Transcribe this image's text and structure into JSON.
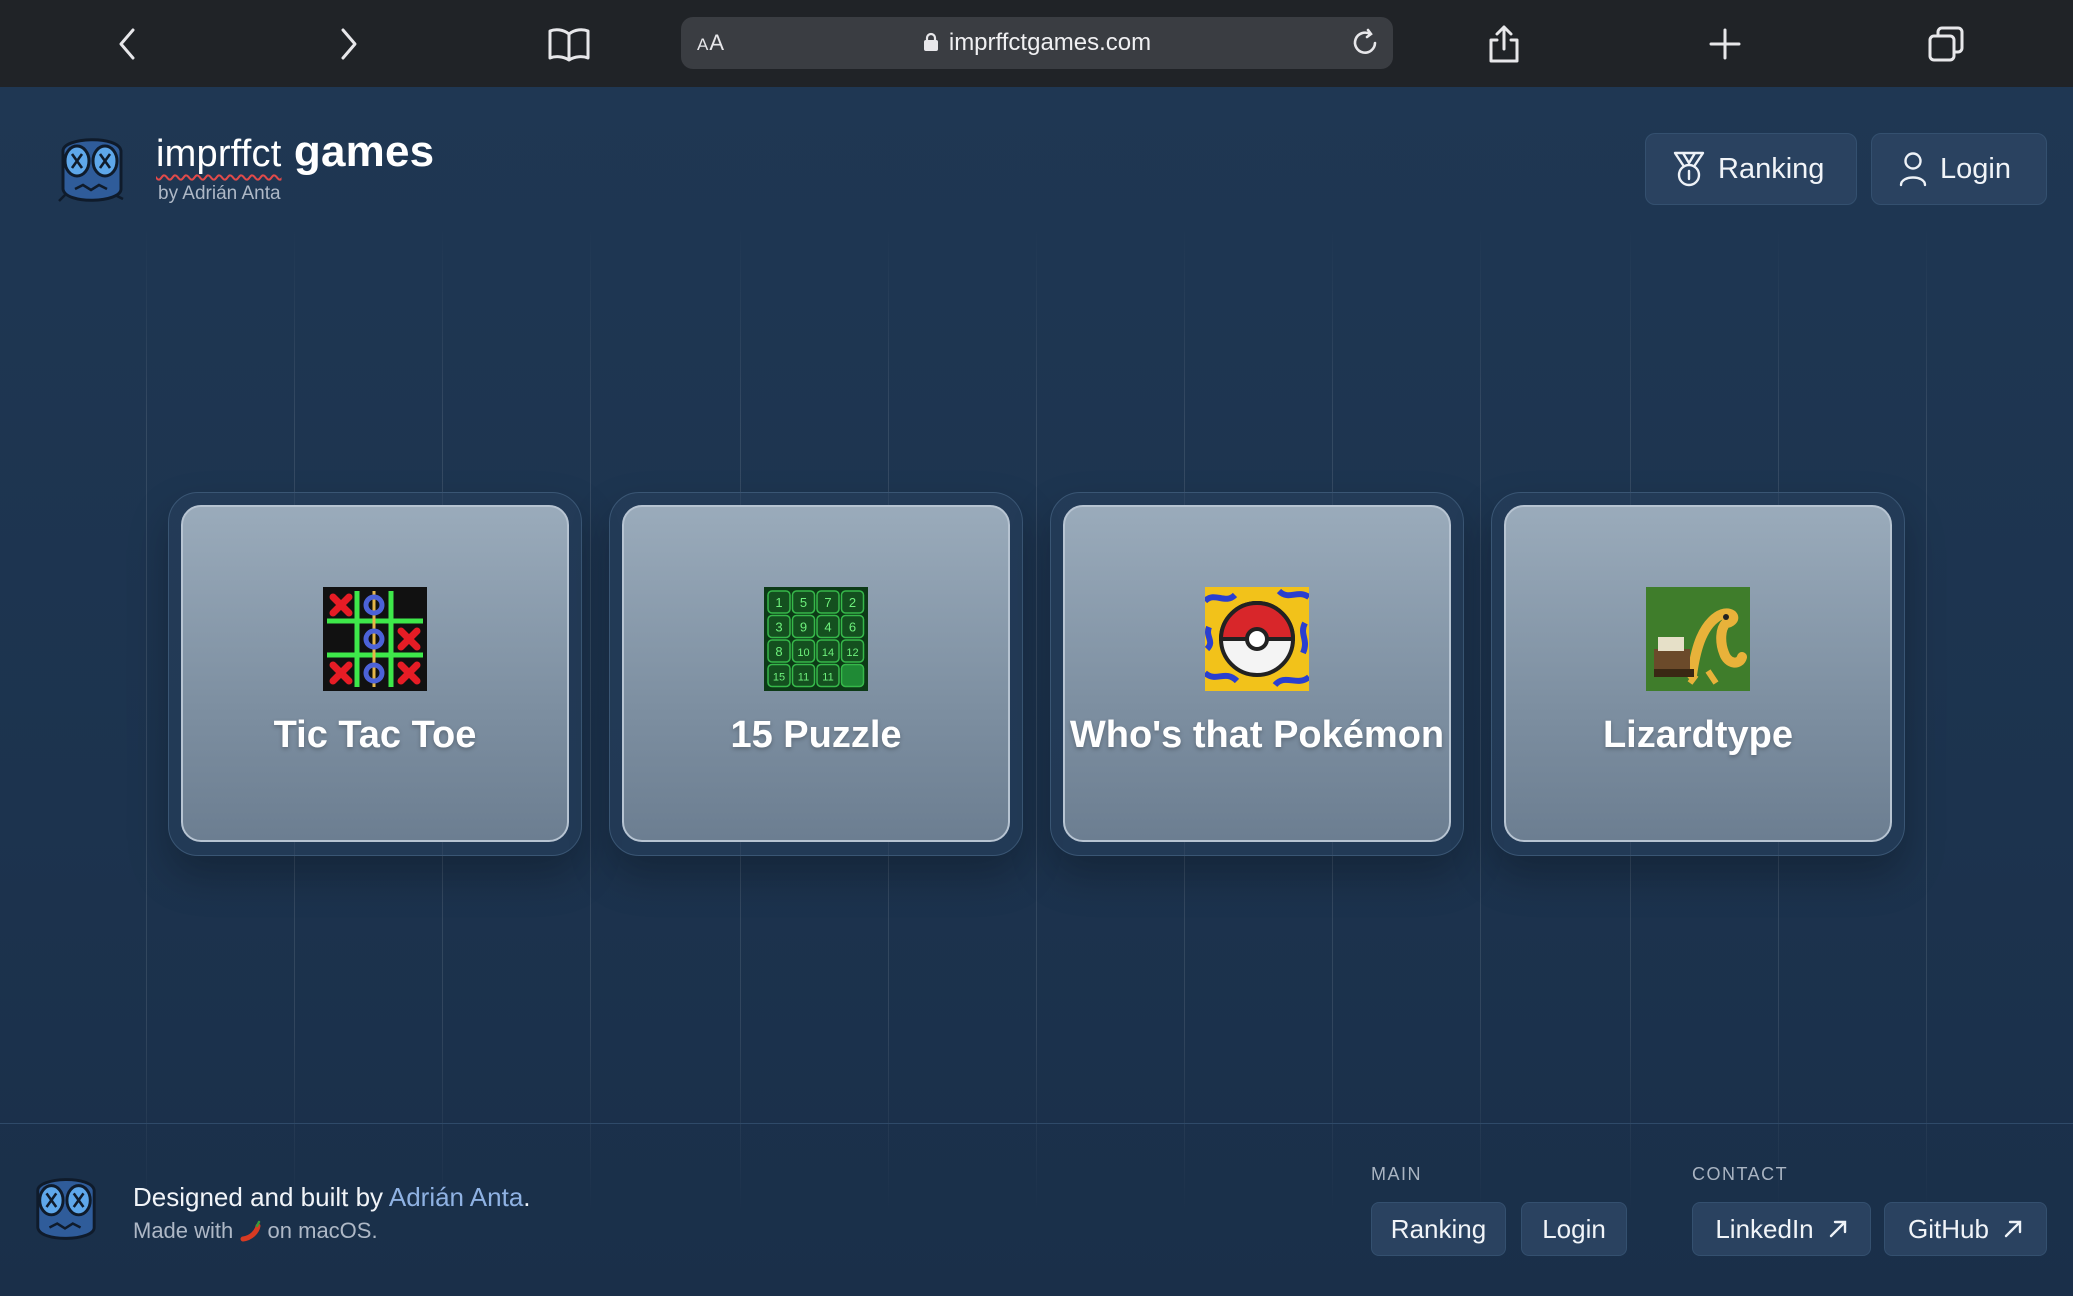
{
  "browser": {
    "reader_label": "AA",
    "url": "imprffctgames.com"
  },
  "header": {
    "brand_part1": "imprffct",
    "brand_part2": "games",
    "byline": "by Adrián Anta",
    "ranking_label": "Ranking",
    "login_label": "Login"
  },
  "games": [
    {
      "title": "Tic Tac Toe",
      "icon": "tic-tac-toe-icon"
    },
    {
      "title": "15 Puzzle",
      "icon": "fifteen-puzzle-icon"
    },
    {
      "title": "Who's that Pokémon",
      "icon": "pokeball-icon"
    },
    {
      "title": "Lizardtype",
      "icon": "lizard-typewriter-icon"
    }
  ],
  "puzzle_tiles": [
    "1",
    "5",
    "7",
    "2",
    "3",
    "9",
    "4",
    "6",
    "8",
    "10",
    "14",
    "12",
    "15",
    "11",
    "11",
    ""
  ],
  "footer": {
    "designed_prefix": "Designed and built by ",
    "author": "Adrián Anta",
    "designed_suffix": ".",
    "made_prefix": "Made with",
    "made_suffix": "on macOS.",
    "main_heading": "MAIN",
    "contact_heading": "CONTACT",
    "ranking_label": "Ranking",
    "login_label": "Login",
    "linkedin_label": "LinkedIn",
    "github_label": "GitHub"
  },
  "colors": {
    "background": "#1d3450",
    "toolbar": "#202327",
    "link": "#8fb2e3",
    "card": "#8a9cae"
  }
}
